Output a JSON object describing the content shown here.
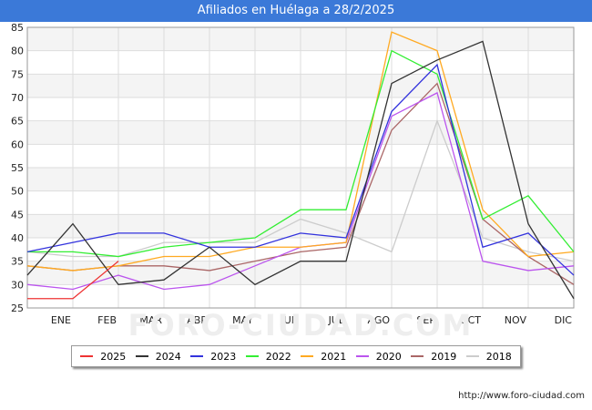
{
  "title": "Afiliados en Huélaga a 28/2/2025",
  "source_label": "http://www.foro-ciudad.com",
  "watermark": "FORO-CIUDAD.COM",
  "chart_data": {
    "type": "line",
    "title": "Afiliados en Huélaga a 28/2/2025",
    "x": [
      "ENE",
      "FEB",
      "MAR",
      "ABR",
      "MAY",
      "JUN",
      "JUL",
      "AGO",
      "SEP",
      "OCT",
      "NOV",
      "DIC"
    ],
    "y_ticks": [
      25,
      30,
      35,
      40,
      45,
      50,
      55,
      60,
      65,
      70,
      75,
      80,
      85
    ],
    "ylim": [
      25,
      85
    ],
    "grid": true,
    "legend_position": "bottom",
    "series": [
      {
        "name": "2025",
        "color": "#ee3333",
        "values": [
          27,
          27,
          35
        ]
      },
      {
        "name": "2024",
        "color": "#333333",
        "values": [
          32,
          43,
          30,
          31,
          38,
          30,
          35,
          35,
          73,
          78,
          82,
          43,
          27
        ]
      },
      {
        "name": "2023",
        "color": "#3333dd",
        "values": [
          37,
          39,
          41,
          41,
          38,
          38,
          41,
          40,
          67,
          77,
          38,
          41,
          32
        ]
      },
      {
        "name": "2022",
        "color": "#33ee33",
        "values": [
          37,
          37,
          36,
          38,
          39,
          40,
          46,
          46,
          80,
          75,
          44,
          49,
          37
        ]
      },
      {
        "name": "2021",
        "color": "#ffaa22",
        "values": [
          34,
          33,
          34,
          36,
          36,
          38,
          38,
          39,
          84,
          80,
          46,
          36,
          37
        ]
      },
      {
        "name": "2020",
        "color": "#bb55ee",
        "values": [
          30,
          29,
          32,
          29,
          30,
          34,
          38,
          39,
          66,
          71,
          35,
          33,
          34
        ]
      },
      {
        "name": "2019",
        "color": "#aa6666",
        "values": [
          34,
          33,
          34,
          34,
          33,
          35,
          37,
          38,
          63,
          73,
          44,
          36,
          30
        ]
      },
      {
        "name": "2018",
        "color": "#cccccc",
        "values": [
          37,
          36,
          36,
          39,
          39,
          39,
          44,
          41,
          37,
          65,
          40,
          37,
          35
        ]
      }
    ]
  }
}
